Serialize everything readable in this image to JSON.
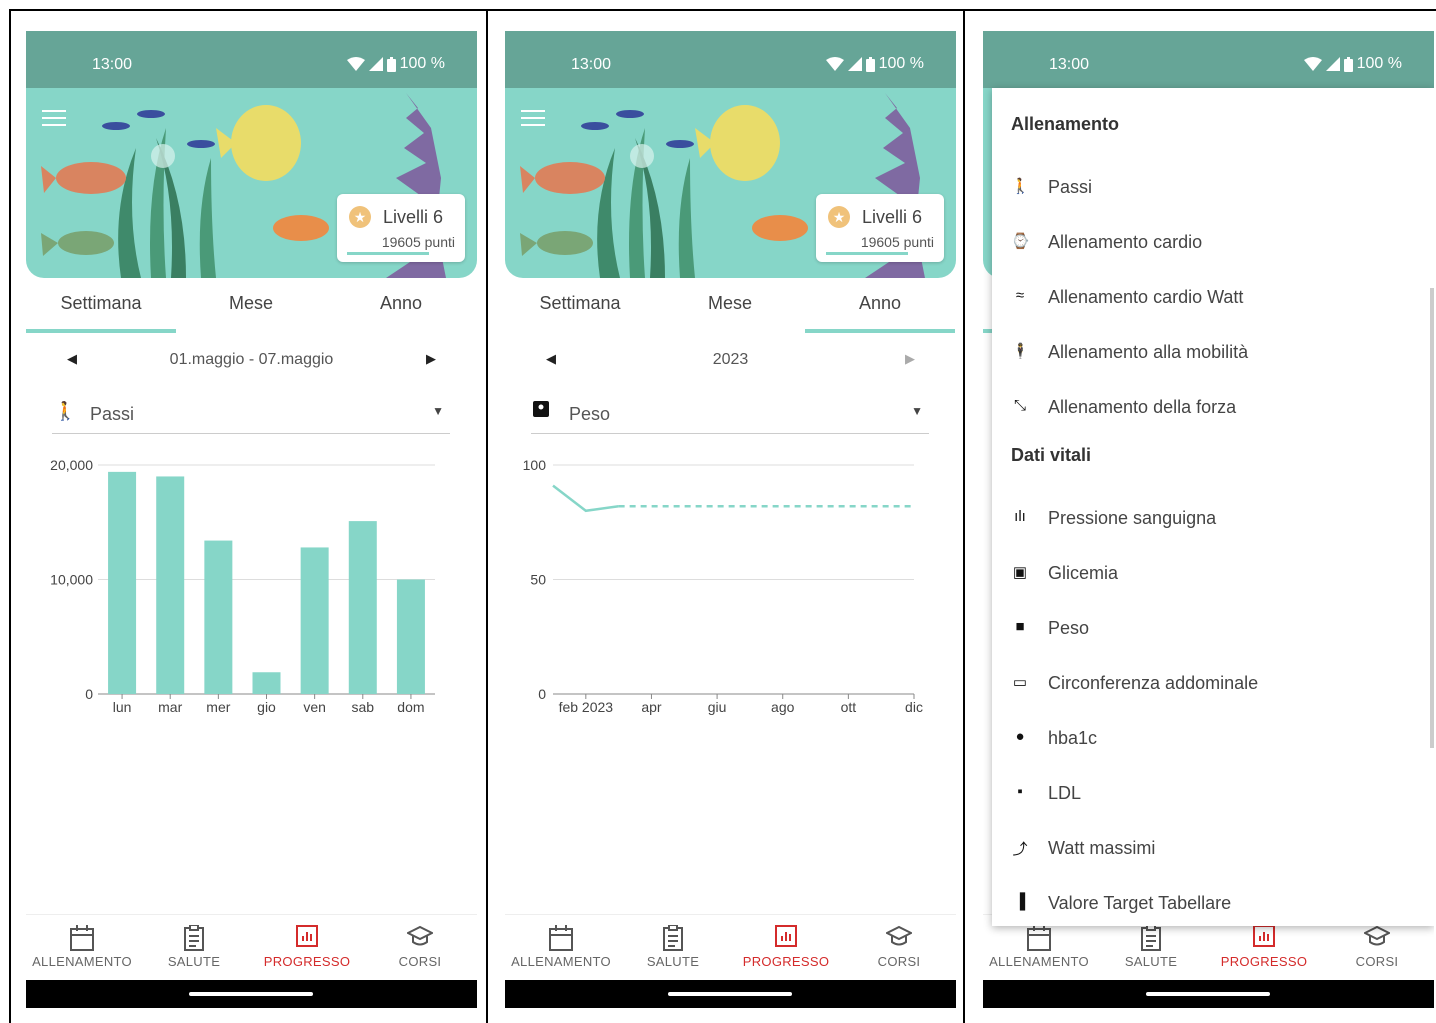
{
  "status": {
    "time": "13:00",
    "battery": "100 %"
  },
  "level": {
    "label": "Livelli 6",
    "points": "19605 punti"
  },
  "tabs": {
    "week": "Settimana",
    "month": "Mese",
    "year": "Anno"
  },
  "nav": {
    "training": "ALLENAMENTO",
    "health": "SALUTE",
    "progress": "PROGRESSO",
    "courses": "CORSI"
  },
  "screen1": {
    "date_range": "01.maggio - 07.maggio",
    "metric": "Passi"
  },
  "screen2": {
    "date_range": "2023",
    "metric": "Peso"
  },
  "chart_data": [
    {
      "type": "bar",
      "categories": [
        "lun",
        "mar",
        "mer",
        "gio",
        "ven",
        "sab",
        "dom"
      ],
      "values": [
        19400,
        19000,
        13400,
        1900,
        12800,
        15100,
        10000
      ],
      "yticks": [
        "0",
        "10,000",
        "20,000"
      ],
      "ylim": [
        0,
        20000
      ],
      "color": "#86d6c8"
    },
    {
      "type": "line",
      "xticks": [
        "feb 2023",
        "apr",
        "giu",
        "ago",
        "ott",
        "dic"
      ],
      "yticks": [
        "0",
        "50",
        "100"
      ],
      "ylim": [
        0,
        100
      ],
      "solid": [
        [
          "gen 2023",
          91
        ],
        [
          "feb 2023",
          80
        ],
        [
          "mar 2023",
          82
        ]
      ],
      "dashed": [
        [
          "mar 2023",
          82
        ],
        [
          "dic 2023",
          82
        ]
      ],
      "color": "#86d6c8"
    }
  ],
  "menu": {
    "section1": "Allenamento",
    "section2": "Dati vitali",
    "items1": [
      {
        "icon": "walk-icon",
        "label": "Passi"
      },
      {
        "icon": "watch-icon",
        "label": "Allenamento cardio"
      },
      {
        "icon": "watt-wave-icon",
        "label": "Allenamento cardio Watt"
      },
      {
        "icon": "mobility-icon",
        "label": "Allenamento alla mobilità"
      },
      {
        "icon": "strength-icon",
        "label": "Allenamento della forza"
      }
    ],
    "items2": [
      {
        "icon": "blood-pressure-icon",
        "label": "Pressione sanguigna"
      },
      {
        "icon": "glucose-icon",
        "label": "Glicemia"
      },
      {
        "icon": "scale-icon",
        "label": "Peso"
      },
      {
        "icon": "tape-icon",
        "label": "Circonferenza addominale"
      },
      {
        "icon": "drop-icon",
        "label": "hba1c"
      },
      {
        "icon": "jar-icon",
        "label": "LDL"
      },
      {
        "icon": "max-watt-icon",
        "label": "Watt massimi"
      },
      {
        "icon": "bar-target-icon",
        "label": "Valore Target Tabellare"
      }
    ]
  }
}
